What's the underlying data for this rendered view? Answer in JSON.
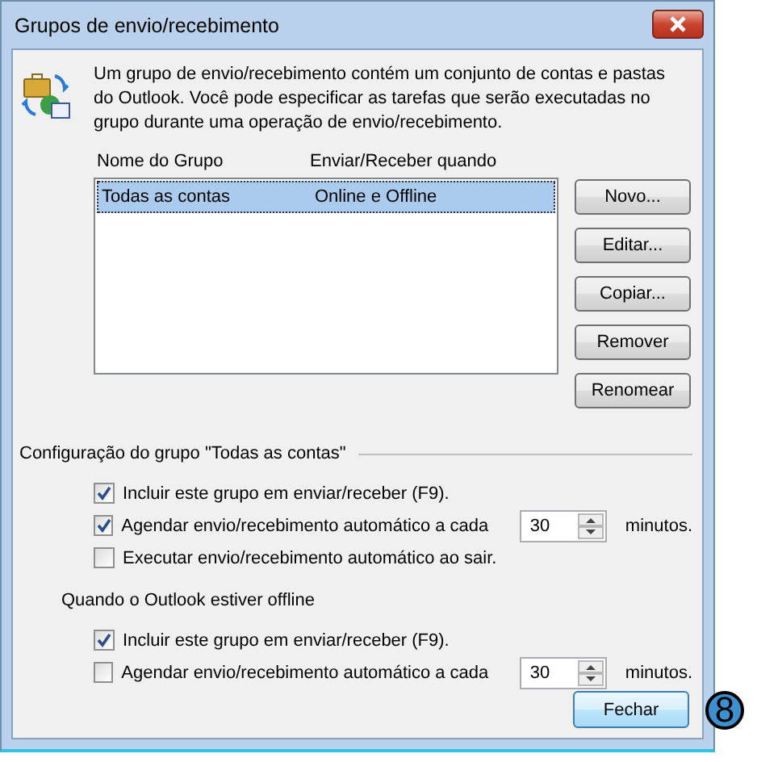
{
  "window": {
    "title": "Grupos de envio/recebimento"
  },
  "description": "Um grupo de envio/recebimento contém um conjunto de contas e pastas do Outlook. Você pode especificar as tarefas que serão executadas no grupo durante uma operação de envio/recebimento.",
  "table": {
    "columns": [
      "Nome do Grupo",
      "Enviar/Receber quando"
    ],
    "rows": [
      {
        "cells": [
          "Todas as contas",
          "Online e Offline"
        ],
        "selected": true
      }
    ]
  },
  "buttons": [
    "Novo...",
    "Editar...",
    "Copiar...",
    "Remover",
    "Renomear"
  ],
  "group_settings": {
    "title": "Configuração do grupo \"Todas as contas\"",
    "options": [
      {
        "kind": "checkbox",
        "label": "Incluir este grupo em enviar/receber (F9).",
        "checked": true
      },
      {
        "kind": "schedule",
        "label": "Agendar envio/recebimento automático a cada",
        "checked": true,
        "value": "30",
        "suffix": "minutos."
      },
      {
        "kind": "checkbox",
        "label": "Executar envio/recebimento automático ao sair.",
        "checked": false
      }
    ]
  },
  "offline_settings": {
    "title": "Quando o Outlook estiver offline",
    "options": [
      {
        "kind": "checkbox",
        "label": "Incluir este grupo em enviar/receber (F9).",
        "checked": true
      },
      {
        "kind": "schedule",
        "label": "Agendar envio/recebimento automático a cada",
        "checked": false,
        "value": "30",
        "suffix": "minutos."
      }
    ]
  },
  "close_button": "Fechar",
  "callout": "8"
}
